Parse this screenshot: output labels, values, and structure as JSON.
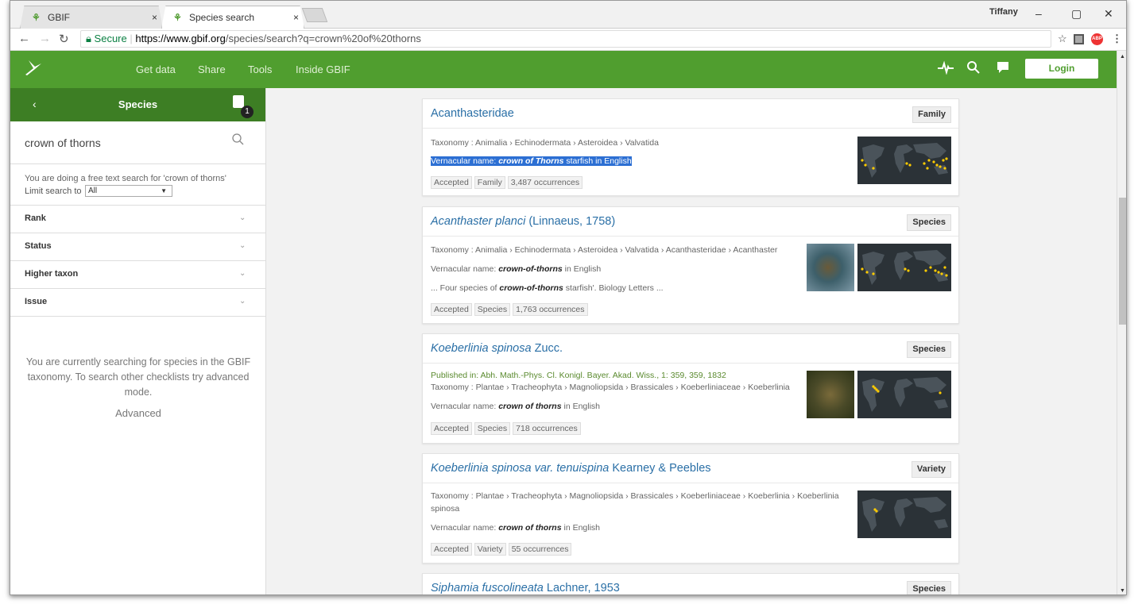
{
  "browser": {
    "tabs": [
      {
        "title": "GBIF",
        "close": "×"
      },
      {
        "title": "Species search",
        "close": "×"
      }
    ],
    "user": "Tiffany",
    "window_controls": [
      "–",
      "▢",
      "✕"
    ],
    "secure_label": "Secure",
    "url_host": "https://www.gbif.org",
    "url_path": "/species/search?q=crown%20of%20thorns"
  },
  "header": {
    "menu": [
      "Get data",
      "Share",
      "Tools",
      "Inside GBIF"
    ],
    "login": "Login"
  },
  "sidebar": {
    "title": "Species",
    "basket_count": "1",
    "search_value": "crown of thorns",
    "free_text_note": "You are doing a free text search for 'crown of thorns'",
    "limit_label": "Limit search to",
    "limit_value": "All",
    "facets": [
      "Rank",
      "Status",
      "Higher taxon",
      "Issue"
    ],
    "note": "You are currently searching for species in the GBIF taxonomy. To search other checklists try advanced mode.",
    "advanced": "Advanced"
  },
  "results": [
    {
      "name": "Acanthasteridae",
      "author": "",
      "rank": "Family",
      "pub": "",
      "taxonomy": "Taxonomy : Animalia › Echinodermata › Asteroidea › Valvatida",
      "vern_pre": "Vernacular name: ",
      "vern_bold": "crown of Thorns",
      "vern_post": " starfish in English",
      "snippet_pre": "",
      "snippet_bold": "",
      "snippet_post": "",
      "tags": [
        "Accepted",
        "Family",
        "3,487 occurrences"
      ]
    },
    {
      "name": "Acanthaster planci",
      "author": " (Linnaeus, 1758)",
      "rank": "Species",
      "pub": "",
      "taxonomy": "Taxonomy : Animalia › Echinodermata › Asteroidea › Valvatida › Acanthasteridae › Acanthaster",
      "vern_pre": "Vernacular name: ",
      "vern_bold": "crown-of-thorns",
      "vern_post": " in English",
      "snippet_pre": "... Four species of ",
      "snippet_bold": "crown-of-thorns",
      "snippet_post": " starfish'. Biology Letters ...",
      "tags": [
        "Accepted",
        "Species",
        "1,763 occurrences"
      ]
    },
    {
      "name": "Koeberlinia spinosa",
      "author": " Zucc.",
      "rank": "Species",
      "pub": "Published in: Abh. Math.-Phys. Cl. Konigl. Bayer. Akad. Wiss., 1: 359, 359, 1832",
      "taxonomy": "Taxonomy : Plantae › Tracheophyta › Magnoliopsida › Brassicales › Koeberliniaceae › Koeberlinia",
      "vern_pre": "Vernacular name: ",
      "vern_bold": "crown of thorns",
      "vern_post": " in English",
      "snippet_pre": "",
      "snippet_bold": "",
      "snippet_post": "",
      "tags": [
        "Accepted",
        "Species",
        "718 occurrences"
      ]
    },
    {
      "name": "Koeberlinia spinosa var. tenuispina",
      "author": " Kearney & Peebles",
      "rank": "Variety",
      "pub": "",
      "taxonomy": "Taxonomy : Plantae › Tracheophyta › Magnoliopsida › Brassicales › Koeberliniaceae › Koeberlinia › Koeberlinia",
      "taxonomy_cont": "spinosa",
      "vern_pre": "Vernacular name: ",
      "vern_bold": "crown of thorns",
      "vern_post": " in English",
      "snippet_pre": "",
      "snippet_bold": "",
      "snippet_post": "",
      "tags": [
        "Accepted",
        "Variety",
        "55 occurrences"
      ]
    },
    {
      "name": "Siphamia fuscolineata",
      "author": " Lachner, 1953",
      "rank": "Species"
    }
  ],
  "colors": {
    "gbif_green": "#509e2f",
    "sidebar_green": "#3d7e24",
    "link_blue": "#2a6fa6",
    "occurrence_dot": "#ffcc00"
  }
}
